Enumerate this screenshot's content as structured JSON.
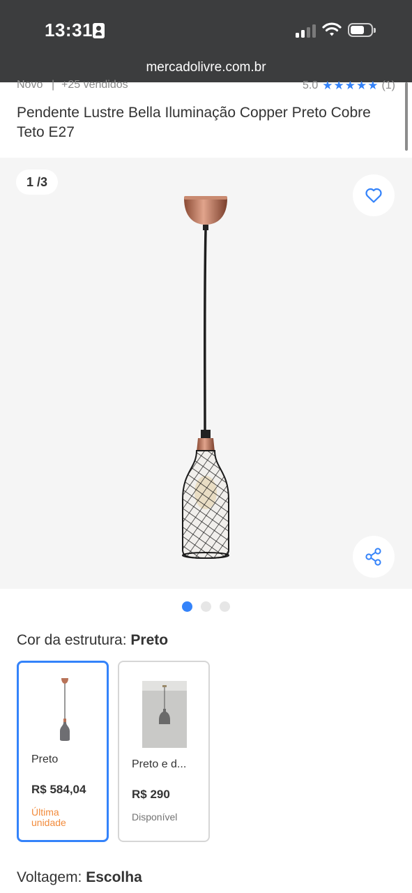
{
  "status_bar": {
    "time": "13:31",
    "url": "mercadolivre.com.br"
  },
  "product": {
    "condition": "Novo",
    "separator": "|",
    "sold": "+25 vendidos",
    "rating_value": "5.0",
    "stars": "★★★★★",
    "rating_count": "(1)",
    "title": "Pendente Lustre Bella Iluminação Copper Preto Cobre Teto E27"
  },
  "gallery": {
    "counter": "1 /3",
    "total_images": 3,
    "active_index": 0
  },
  "color_option": {
    "label": "Cor da estrutura: ",
    "selected": "Preto",
    "variants": [
      {
        "name": "Preto",
        "price": "R$ 584,04",
        "status": "Última unidade",
        "status_color": "#f28b3c",
        "selected": true
      },
      {
        "name": "Preto e d...",
        "price": "R$ 290",
        "status": "Disponível",
        "status_color": "#737373",
        "selected": false
      }
    ]
  },
  "voltage_option": {
    "label": "Voltagem: ",
    "selected": "Escolha"
  },
  "colors": {
    "accent": "#3483fa",
    "topbar": "#3c3d3e",
    "gallery_bg": "#f5f5f5",
    "copper": "#b87358"
  }
}
